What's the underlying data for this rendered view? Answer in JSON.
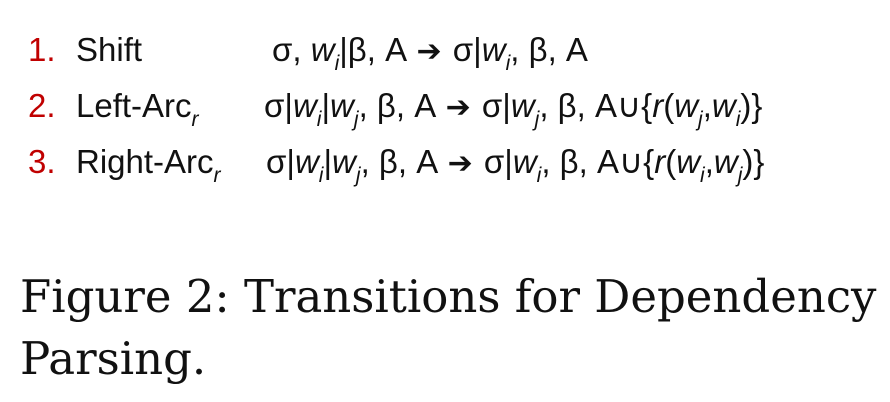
{
  "rules": [
    {
      "number": "1.",
      "name": "Shift",
      "name_subscript": "",
      "formula": {
        "p1": "σ, ",
        "w1": "w",
        "w1_sub": "i",
        "p2": "|β, A ",
        "arrow": "➔",
        "p3": " σ|",
        "w2": "w",
        "w2_sub": "i",
        "p4": ", β, A"
      }
    },
    {
      "number": "2.",
      "name": "Left-Arc",
      "name_subscript": "r",
      "formula": {
        "p1": "σ|",
        "w1": "w",
        "w1_sub": "i",
        "p2": "|",
        "w2": "w",
        "w2_sub": "j",
        "p3": ", β, A ",
        "arrow": "➔",
        "p4": " σ|",
        "w3": "w",
        "w3_sub": "j",
        "p5": ", β, A∪{",
        "r": "r",
        "p6": "(",
        "w4": "w",
        "w4_sub": "j",
        "p7": ",",
        "w5": "w",
        "w5_sub": "i",
        "p8": ")}"
      }
    },
    {
      "number": "3.",
      "name": "Right-Arc",
      "name_subscript": "r",
      "formula": {
        "p1": "σ|",
        "w1": "w",
        "w1_sub": "i",
        "p2": "|",
        "w2": "w",
        "w2_sub": "j",
        "p3": ", β, A ",
        "arrow": "➔",
        "p4": " σ|",
        "w3": "w",
        "w3_sub": "i",
        "p5": ", β, A∪{",
        "r": "r",
        "p6": "(",
        "w4": "w",
        "w4_sub": "i",
        "p7": ",",
        "w5": "w",
        "w5_sub": "j",
        "p8": ")}"
      }
    }
  ],
  "caption": "Figure 2: Transitions for Dependency Parsing."
}
